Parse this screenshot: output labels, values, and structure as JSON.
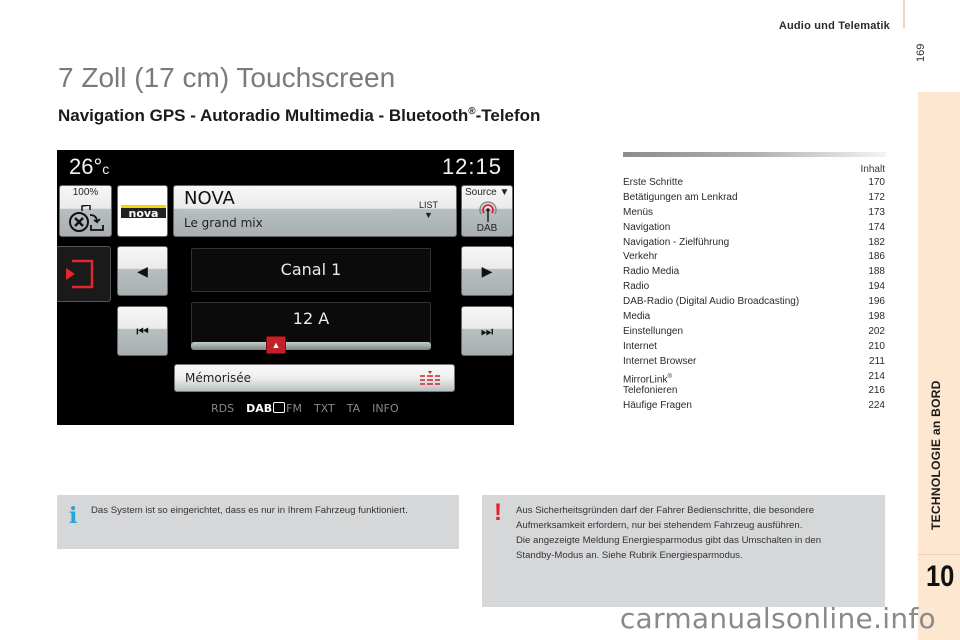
{
  "header": {
    "running_head": "Audio und Telematik",
    "page_number": "169"
  },
  "side_tab": {
    "title": "TECHNOLOGIE an BORD",
    "chapter_number": "10"
  },
  "title": "7 Zoll (17 cm) Touchscreen",
  "subtitle": {
    "text_before": "Navigation GPS - Autoradio Multimedia - Bluetooth",
    "sup": "®",
    "text_after": "-Telefon"
  },
  "screen": {
    "temperature": "26°",
    "temperature_unit": "c",
    "time": "12:15",
    "volume_label": "100%",
    "logo_text": "nova",
    "station_name": "NOVA",
    "program": "Le grand mix",
    "list_label": "LIST",
    "source_label": "Source ▼",
    "source_value": "DAB",
    "prev_glyph": "◀",
    "next_glyph": "▶",
    "skip_back_glyph": "⏮",
    "skip_forward_glyph": "⏭",
    "channel": "Canal 1",
    "frequency": "12 A",
    "slider_glyph": "▲",
    "memorised_label": "Mémorisée",
    "modes": {
      "rds": "RDS",
      "dab": "DAB",
      "fm": "FM",
      "txt": "TXT",
      "ta": "TA",
      "info": "INFO"
    },
    "accent_color": "#c4202a"
  },
  "toc": {
    "heading": "Inhalt",
    "items": [
      {
        "label": "Erste Schritte",
        "page": "170"
      },
      {
        "label": "Betätigungen am Lenkrad",
        "page": "172"
      },
      {
        "label": "Menüs",
        "page": "173"
      },
      {
        "label": "Navigation",
        "page": "174"
      },
      {
        "label": "Navigation - Zielführung",
        "page": "182"
      },
      {
        "label": "Verkehr",
        "page": "186"
      },
      {
        "label": "Radio Media",
        "page": "188"
      },
      {
        "label": "Radio",
        "page": "194"
      },
      {
        "label": "DAB-Radio (Digital Audio Broadcasting)",
        "page": "196"
      },
      {
        "label": "Media",
        "page": "198"
      },
      {
        "label": "Einstellungen",
        "page": "202"
      },
      {
        "label": "Internet",
        "page": "210"
      },
      {
        "label": "Internet Browser",
        "page": "211"
      },
      {
        "label": "MirrorLink",
        "sup": "®",
        "page": "214"
      },
      {
        "label": "Telefonieren",
        "page": "216"
      },
      {
        "label": "Häufige Fragen",
        "page": "224"
      }
    ]
  },
  "notes": {
    "info": {
      "icon": "i",
      "text": "Das System ist so eingerichtet, dass es nur in Ihrem Fahrzeug funktioniert.",
      "color": "#25a6d8"
    },
    "warning": {
      "icon": "!",
      "lines": [
        "Aus Sicherheitsgründen darf der Fahrer Bedienschritte, die besondere",
        "Aufmerksamkeit erfordern, nur bei stehendem Fahrzeug ausführen.",
        "Die angezeigte Meldung Energiesparmodus gibt das Umschalten in den",
        "Standby-Modus an. Siehe Rubrik Energiesparmodus."
      ],
      "color": "#e4202e"
    }
  },
  "watermark": "carmanualsonline.info"
}
